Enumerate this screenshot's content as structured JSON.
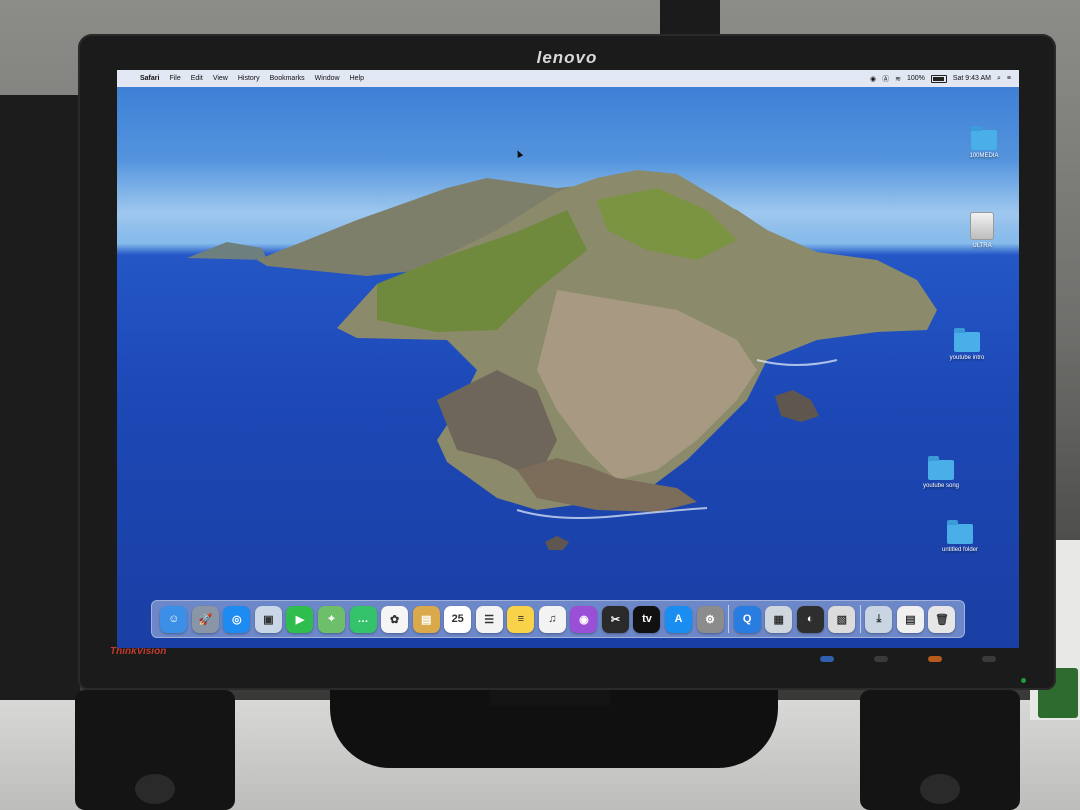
{
  "monitor": {
    "brand": "lenovo",
    "sub_brand": "ThinkVision"
  },
  "menubar": {
    "apple_glyph": "",
    "app_name": "Safari",
    "items": [
      "File",
      "Edit",
      "View",
      "History",
      "Bookmarks",
      "Window",
      "Help"
    ],
    "battery_percent": "100%",
    "clock": "Sat 9:43 AM",
    "status_icons": [
      "siri-icon",
      "input-source-icon",
      "wifi-icon",
      "battery-icon",
      "search-icon",
      "control-center-icon"
    ]
  },
  "desktop_icons": [
    {
      "name": "folder-100media",
      "type": "folder",
      "label": "100MEDIA"
    },
    {
      "name": "drive-icon",
      "type": "drive",
      "label": "ULTRA"
    },
    {
      "name": "folder-youtube-intro",
      "type": "folder",
      "label": "youtube intro"
    },
    {
      "name": "folder-youtube-song",
      "type": "folder",
      "label": "youtube song"
    },
    {
      "name": "folder-untitled",
      "type": "folder",
      "label": "untitled folder"
    }
  ],
  "dock": {
    "items": [
      {
        "name": "finder",
        "color": "#3b8fe6",
        "glyph": "☺"
      },
      {
        "name": "launchpad",
        "color": "#8a96a6",
        "glyph": "🚀"
      },
      {
        "name": "safari",
        "color": "#1e8bf0",
        "glyph": "◎"
      },
      {
        "name": "preview",
        "color": "#c9d7e6",
        "glyph": "▣"
      },
      {
        "name": "facetime",
        "color": "#2fbd4e",
        "glyph": "▶"
      },
      {
        "name": "maps",
        "color": "#6ebf6a",
        "glyph": "⌖"
      },
      {
        "name": "messages",
        "color": "#34c26a",
        "glyph": "…"
      },
      {
        "name": "photos",
        "color": "#f5f5f5",
        "glyph": "✿"
      },
      {
        "name": "notes-book",
        "color": "#d9a94b",
        "glyph": "▤"
      },
      {
        "name": "calendar",
        "color": "#ffffff",
        "glyph": "25"
      },
      {
        "name": "reminders",
        "color": "#f3f3f3",
        "glyph": "☰"
      },
      {
        "name": "notes",
        "color": "#f8d34a",
        "glyph": "≡"
      },
      {
        "name": "music",
        "color": "#f3f3f3",
        "glyph": "♫"
      },
      {
        "name": "podcasts",
        "color": "#9b4fd6",
        "glyph": "◉"
      },
      {
        "name": "final-cut",
        "color": "#2a2a2a",
        "glyph": "✂"
      },
      {
        "name": "apple-tv",
        "color": "#111111",
        "glyph": "tv"
      },
      {
        "name": "app-store",
        "color": "#1a8ef0",
        "glyph": "A"
      },
      {
        "name": "system-preferences",
        "color": "#8c8c8c",
        "glyph": "⚙"
      },
      {
        "name": "quicktime",
        "color": "#2a7de0",
        "glyph": "Q"
      },
      {
        "name": "image-capture",
        "color": "#cfd6de",
        "glyph": "▦"
      },
      {
        "name": "istat-menus",
        "color": "#2e2e2e",
        "glyph": "◐"
      },
      {
        "name": "photo-booth",
        "color": "#dcdcdc",
        "glyph": "▧"
      },
      {
        "name": "downloads-stack",
        "color": "#c9d5e2",
        "glyph": "⤓"
      },
      {
        "name": "document-stack",
        "color": "#f0f0f0",
        "glyph": "▤"
      },
      {
        "name": "trash",
        "color": "#e6e6e6",
        "glyph": "🗑"
      }
    ]
  }
}
